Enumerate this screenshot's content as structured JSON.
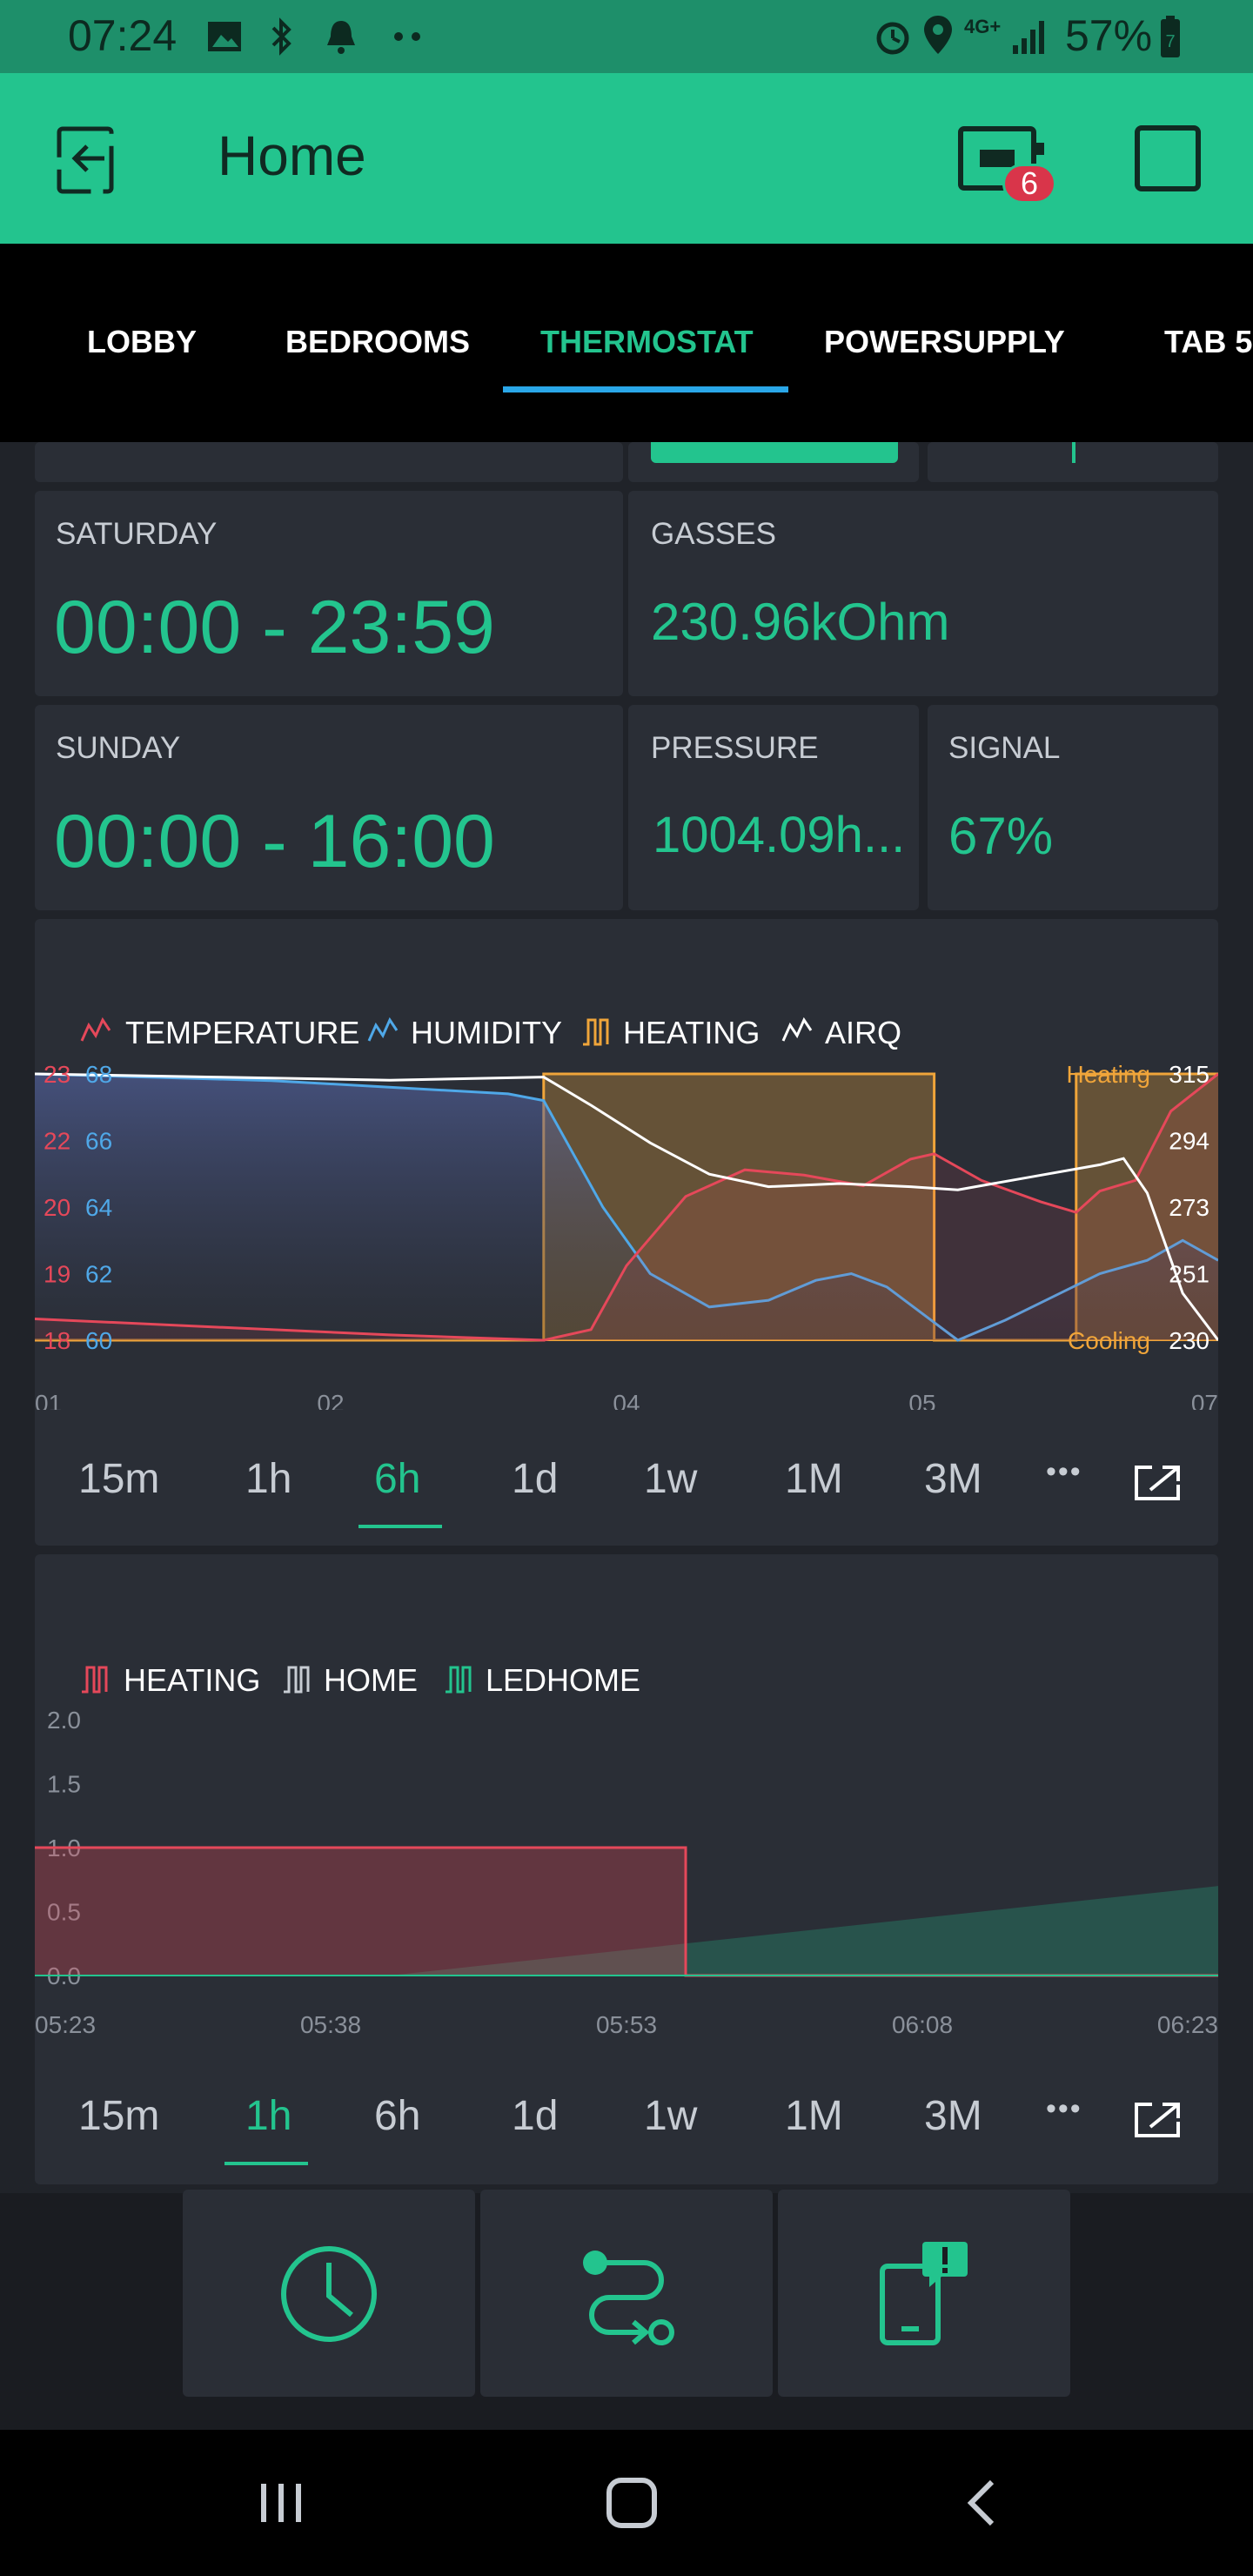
{
  "status_bar": {
    "time": "07:24",
    "battery": "57%",
    "network": "4G+",
    "battery_level": "7"
  },
  "app_bar": {
    "title": "Home",
    "device_badge": "6"
  },
  "tabs": [
    "LOBBY",
    "BEDROOMS",
    "THERMOSTAT",
    "POWERSUPPLY",
    "TAB 5"
  ],
  "active_tab": "THERMOSTAT",
  "widgets": {
    "saturday": {
      "label": "SATURDAY",
      "value": "00:00 - 23:59"
    },
    "gasses": {
      "label": "GASSES",
      "value": "230.96kOhm"
    },
    "sunday": {
      "label": "SUNDAY",
      "value": "00:00 - 16:00"
    },
    "pressure": {
      "label": "PRESSURE",
      "value": "1004.09h..."
    },
    "signal": {
      "label": "SIGNAL",
      "value": "67%"
    }
  },
  "colors": {
    "accent": "#23c48e",
    "temperature": "#e5485a",
    "humidity": "#4fa8e8",
    "heating": "#f0a53a",
    "airq": "#ffffff",
    "ledhome": "#23c48e",
    "home": "#c7ccd3"
  },
  "chart_data": [
    {
      "type": "line",
      "legend": [
        "TEMPERATURE",
        "HUMIDITY",
        "HEATING",
        "AIRQ"
      ],
      "x_ticks": [
        "01",
        "02",
        "04",
        "05",
        "07"
      ],
      "series": [
        {
          "name": "TEMPERATURE",
          "y_ticks": [
            "23",
            "22",
            "20",
            "19",
            "18"
          ],
          "ylim": [
            18,
            23
          ],
          "points": [
            [
              0,
              18.4
            ],
            [
              0.15,
              18.25
            ],
            [
              0.3,
              18.1
            ],
            [
              0.43,
              18.0
            ],
            [
              0.47,
              18.2
            ],
            [
              0.5,
              19.4
            ],
            [
              0.55,
              20.7
            ],
            [
              0.6,
              21.2
            ],
            [
              0.65,
              21.1
            ],
            [
              0.7,
              20.9
            ],
            [
              0.74,
              21.4
            ],
            [
              0.76,
              21.5
            ],
            [
              0.8,
              21.0
            ],
            [
              0.85,
              20.6
            ],
            [
              0.88,
              20.4
            ],
            [
              0.9,
              20.8
            ],
            [
              0.93,
              21.0
            ],
            [
              0.96,
              22.3
            ],
            [
              1.0,
              23.0
            ]
          ]
        },
        {
          "name": "HUMIDITY",
          "y_ticks": [
            "68",
            "66",
            "64",
            "62",
            "60"
          ],
          "ylim": [
            60,
            68
          ],
          "points": [
            [
              0,
              68
            ],
            [
              0.2,
              67.8
            ],
            [
              0.4,
              67.4
            ],
            [
              0.43,
              67.2
            ],
            [
              0.48,
              64
            ],
            [
              0.52,
              62.0
            ],
            [
              0.57,
              61.0
            ],
            [
              0.62,
              61.2
            ],
            [
              0.66,
              61.8
            ],
            [
              0.69,
              62.0
            ],
            [
              0.72,
              61.6
            ],
            [
              0.78,
              60.0
            ],
            [
              0.82,
              60.6
            ],
            [
              0.86,
              61.3
            ],
            [
              0.9,
              62.0
            ],
            [
              0.94,
              62.4
            ],
            [
              0.97,
              63.0
            ],
            [
              1.0,
              62.4
            ]
          ]
        },
        {
          "name": "HEATING",
          "y_ticks": [
            "Heating",
            "Cooling"
          ],
          "ylim": [
            0,
            1
          ],
          "points": [
            [
              0,
              0
            ],
            [
              0.43,
              0
            ],
            [
              0.43,
              1
            ],
            [
              0.76,
              1
            ],
            [
              0.76,
              0
            ],
            [
              0.88,
              0
            ],
            [
              0.88,
              1
            ],
            [
              1.0,
              1
            ]
          ]
        },
        {
          "name": "AIRQ",
          "y_ticks": [
            "315",
            "294",
            "273",
            "251",
            "230"
          ],
          "ylim": [
            230,
            315
          ],
          "points": [
            [
              0,
              315
            ],
            [
              0.15,
              314
            ],
            [
              0.3,
              313
            ],
            [
              0.43,
              314
            ],
            [
              0.47,
              305
            ],
            [
              0.52,
              293
            ],
            [
              0.57,
              283
            ],
            [
              0.62,
              279
            ],
            [
              0.68,
              280
            ],
            [
              0.74,
              279
            ],
            [
              0.78,
              278
            ],
            [
              0.84,
              282
            ],
            [
              0.9,
              286
            ],
            [
              0.92,
              288
            ],
            [
              0.94,
              277
            ],
            [
              0.97,
              245
            ],
            [
              1.0,
              230
            ]
          ]
        }
      ]
    },
    {
      "type": "area",
      "legend": [
        "HEATING",
        "HOME",
        "LEDHOME"
      ],
      "x_ticks": [
        "05:23",
        "05:38",
        "05:53",
        "06:08",
        "06:23"
      ],
      "y_ticks": [
        "2.0",
        "1.5",
        "1.0",
        "0.5",
        "0.0"
      ],
      "ylim": [
        0,
        2
      ],
      "series": [
        {
          "name": "HEATING",
          "points": [
            [
              0,
              1
            ],
            [
              0.55,
              1
            ],
            [
              0.55,
              0
            ],
            [
              1,
              0
            ]
          ]
        },
        {
          "name": "HOME",
          "points": [
            [
              0,
              0
            ],
            [
              1,
              0
            ]
          ]
        },
        {
          "name": "LEDHOME",
          "points": [
            [
              0,
              0
            ],
            [
              0.3,
              0
            ],
            [
              1,
              0.7
            ]
          ]
        }
      ]
    }
  ],
  "ranges": [
    "15m",
    "1h",
    "6h",
    "1d",
    "1w",
    "1M",
    "3M"
  ],
  "range_active_chart1": "6h",
  "range_active_chart2": "1h",
  "more_label": "•••"
}
